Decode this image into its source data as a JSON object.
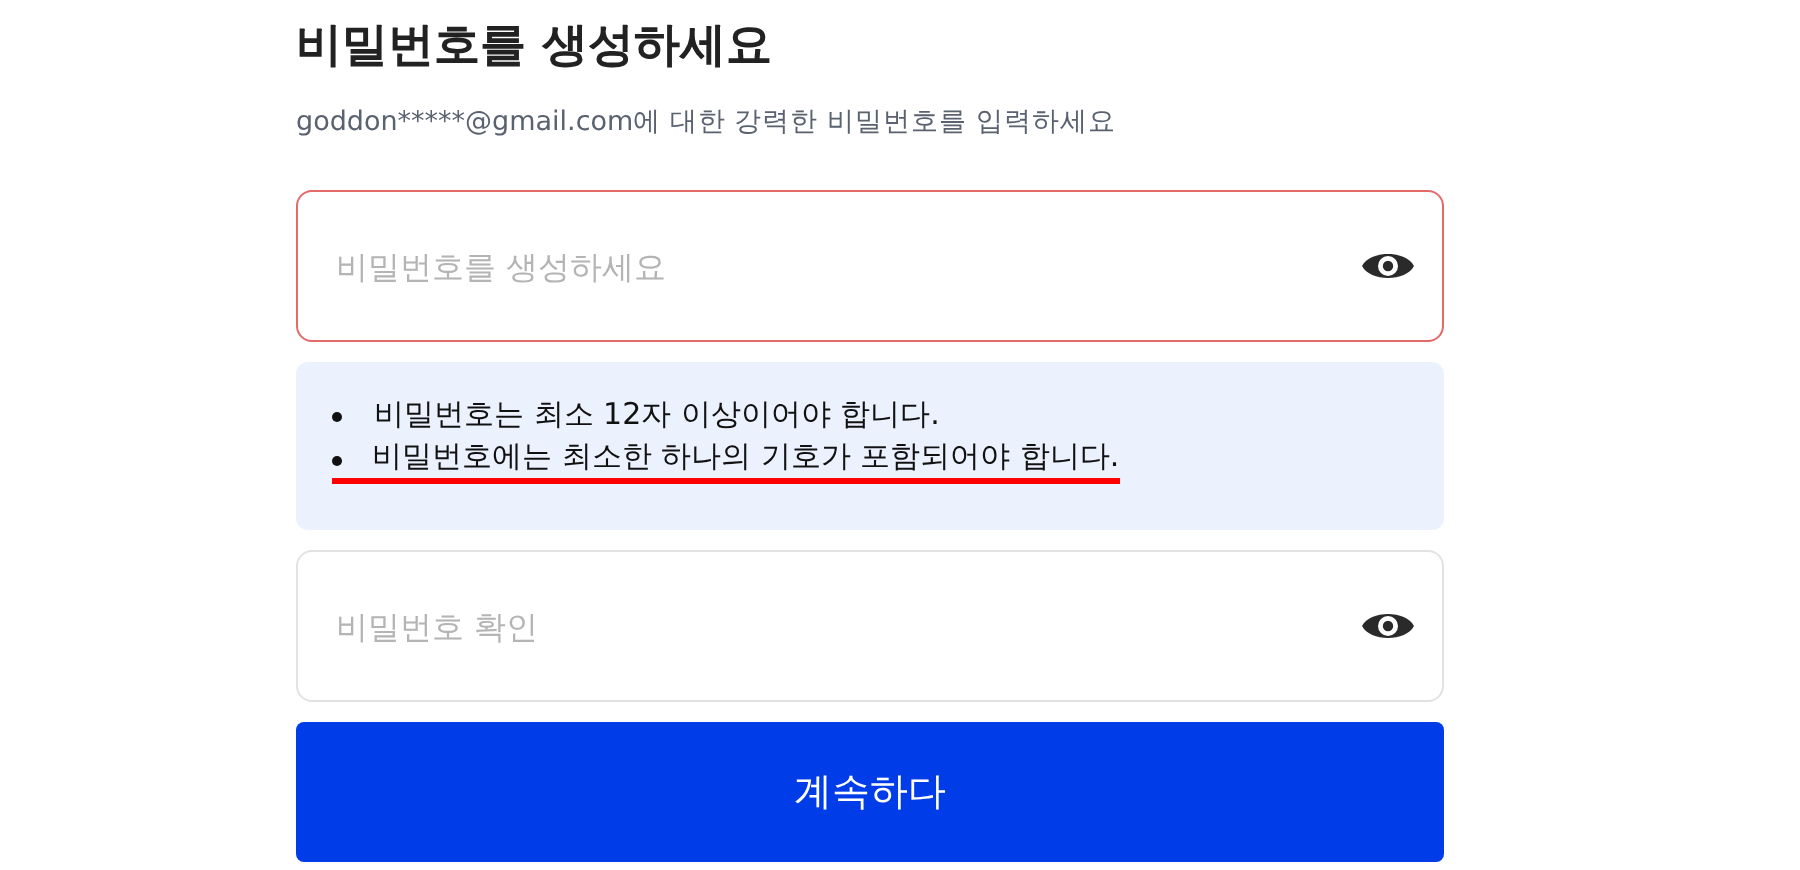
{
  "title": "비밀번호를 생성하세요",
  "subtitle": "goddon*****@gmail.com에 대한 강력한 비밀번호를 입력하세요",
  "password_field": {
    "placeholder": "비밀번호를 생성하세요",
    "error": true
  },
  "rules": [
    {
      "text": "비밀번호는 최소 12자 이상이어야 합니다.",
      "highlighted": false
    },
    {
      "text": "비밀번호에는 최소한 하나의 기호가 포함되어야 합니다.",
      "highlighted": true
    }
  ],
  "confirm_field": {
    "placeholder": "비밀번호 확인",
    "error": false
  },
  "continue_button": {
    "label": "계속하다"
  }
}
